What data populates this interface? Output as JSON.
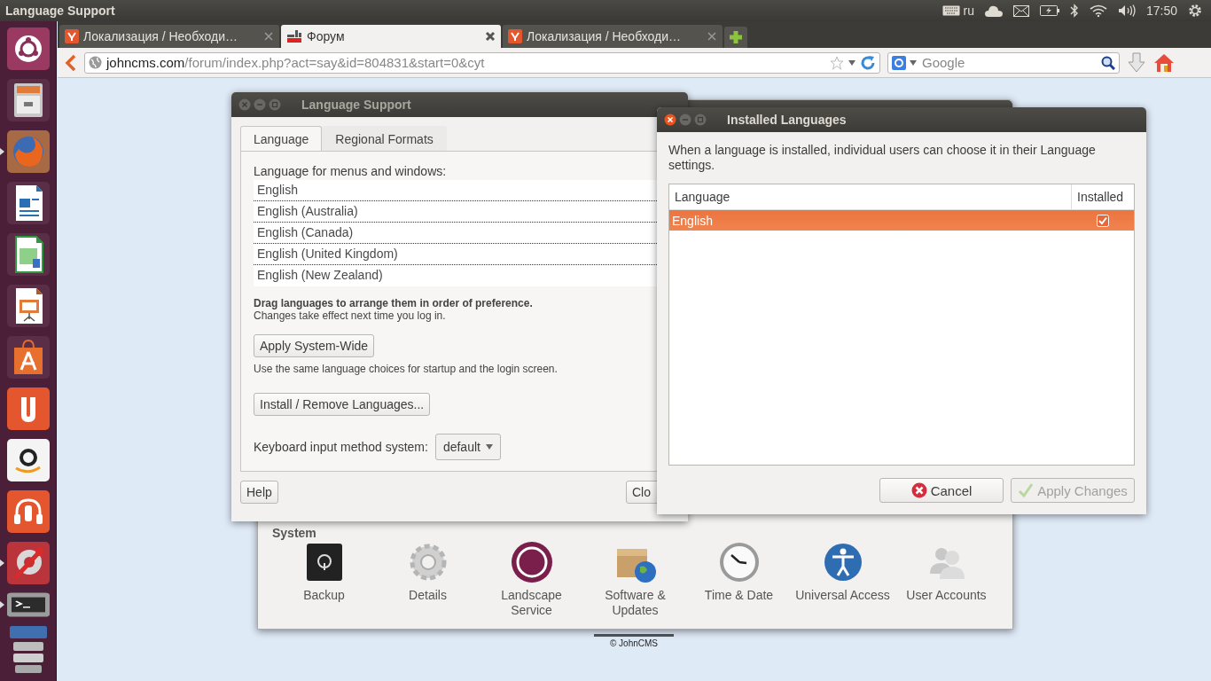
{
  "top_panel": {
    "title": "Language Support",
    "keyboard_layout": "ru",
    "clock": "17:50"
  },
  "launcher": [
    {
      "kind": "ubuntu",
      "running": false
    },
    {
      "kind": "files",
      "running": false
    },
    {
      "kind": "firefox",
      "running": true
    },
    {
      "kind": "writer",
      "running": false
    },
    {
      "kind": "calc",
      "running": false
    },
    {
      "kind": "impress",
      "running": false
    },
    {
      "kind": "software",
      "running": false
    },
    {
      "kind": "ubuntuone",
      "running": false
    },
    {
      "kind": "amazon",
      "running": false
    },
    {
      "kind": "music",
      "running": false
    },
    {
      "kind": "settings",
      "running": true
    },
    {
      "kind": "terminal",
      "running": true
    },
    {
      "kind": "stack",
      "running": false
    }
  ],
  "browser": {
    "tabs": [
      {
        "label": "Локализация / Необходи…",
        "kind": "article",
        "selected": false
      },
      {
        "label": "Форум",
        "kind": "forum",
        "selected": true
      },
      {
        "label": "Локализация / Необходи…",
        "kind": "article",
        "selected": false
      }
    ],
    "url": {
      "host": "johncms.com",
      "path": "/forum/index.php?act=say&id=804831&start=0&cyt"
    },
    "search_placeholder": "Google",
    "footer": "© JohnCMS"
  },
  "system_settings": {
    "section": "System",
    "items": [
      {
        "label": "Backup",
        "kind": "backup"
      },
      {
        "label": "Details",
        "kind": "details"
      },
      {
        "label": "Landscape Service",
        "kind": "landscape"
      },
      {
        "label": "Software & Updates",
        "kind": "software"
      },
      {
        "label": "Time & Date",
        "kind": "time"
      },
      {
        "label": "Universal Access",
        "kind": "access"
      },
      {
        "label": "User Accounts",
        "kind": "users"
      }
    ]
  },
  "language_support": {
    "title": "Language Support",
    "tabs": [
      {
        "label": "Language",
        "selected": true
      },
      {
        "label": "Regional Formats",
        "selected": false
      }
    ],
    "list_label": "Language for menus and windows:",
    "languages": [
      "English",
      "English (Australia)",
      "English (Canada)",
      "English (United Kingdom)",
      "English (New Zealand)"
    ],
    "hint": "Drag languages to arrange them in order of preference.",
    "note": "Changes take effect next time you log in.",
    "apply_button": "Apply System-Wide",
    "apply_note": "Use the same language choices for startup and the login screen.",
    "install_button": "Install / Remove Languages...",
    "input_label": "Keyboard input method system:",
    "input_value": "default",
    "help_button": "Help",
    "close_button": "Clo"
  },
  "installed_languages": {
    "title": "Installed Languages",
    "description": "When a language is installed, individual users can choose it in their Language settings.",
    "columns": [
      "Language",
      "Installed"
    ],
    "rows": [
      {
        "language": "English",
        "installed": true,
        "selected": true
      }
    ],
    "buttons": [
      {
        "label": "Cancel",
        "kind": "cancel",
        "disabled": false
      },
      {
        "label": "Apply Changes",
        "kind": "apply",
        "disabled": true
      }
    ]
  }
}
